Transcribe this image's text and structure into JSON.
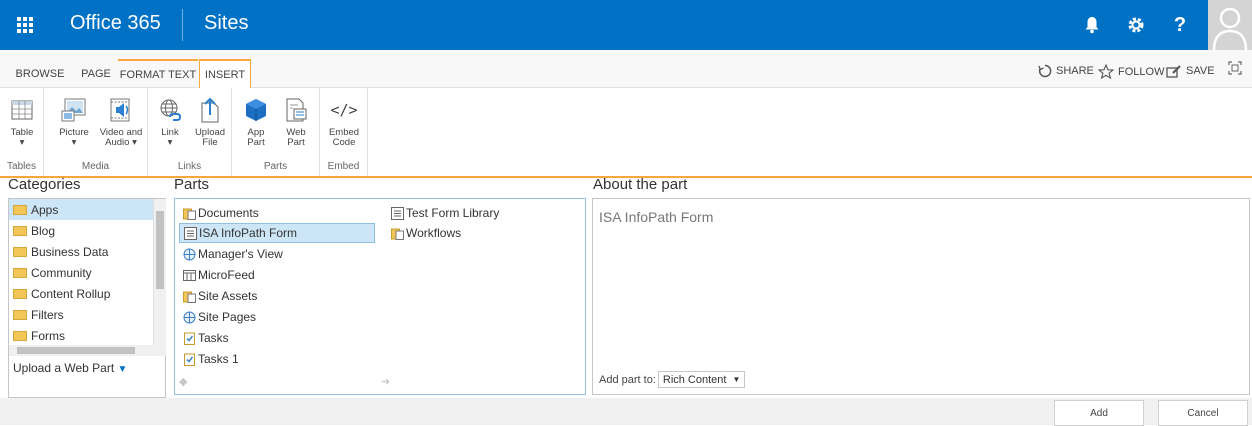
{
  "suitebar": {
    "brand": "Office 365",
    "app_title": "Sites",
    "help_label": "?"
  },
  "tabs": {
    "browse": "BROWSE",
    "page": "PAGE",
    "format_text": "FORMAT TEXT",
    "insert": "INSERT",
    "share": "SHARE",
    "follow": "FOLLOW",
    "save": "SAVE"
  },
  "ribbon": {
    "groups": {
      "tables": "Tables",
      "media": "Media",
      "links": "Links",
      "parts": "Parts",
      "embed": "Embed"
    },
    "buttons": {
      "table": "Table",
      "picture": "Picture",
      "video_audio_1": "Video and",
      "video_audio_2": "Audio ▾",
      "link": "Link",
      "upload_1": "Upload",
      "upload_2": "File",
      "app_1": "App",
      "app_2": "Part",
      "web_1": "Web",
      "web_2": "Part",
      "embed_1": "Embed",
      "embed_2": "Code",
      "embed_glyph": "</>"
    }
  },
  "categories": {
    "heading": "Categories",
    "items": [
      "Apps",
      "Blog",
      "Business Data",
      "Community",
      "Content Rollup",
      "Filters",
      "Forms"
    ],
    "upload_label": "Upload a Web Part"
  },
  "parts": {
    "heading": "Parts",
    "col1": [
      "Documents",
      "ISA InfoPath Form",
      "Manager's View",
      "MicroFeed",
      "Site Assets",
      "Site Pages",
      "Tasks",
      "Tasks 1"
    ],
    "col2": [
      "Test Form Library",
      "Workflows"
    ]
  },
  "about": {
    "heading": "About the part",
    "title": "ISA InfoPath Form",
    "add_part_to_label": "Add part to:",
    "add_part_to_value": "Rich Content"
  },
  "footer": {
    "add": "Add",
    "cancel": "Cancel"
  },
  "colors": {
    "suitebar": "#0072c6",
    "accent": "#f7a73c",
    "selection": "#cde6f7"
  }
}
